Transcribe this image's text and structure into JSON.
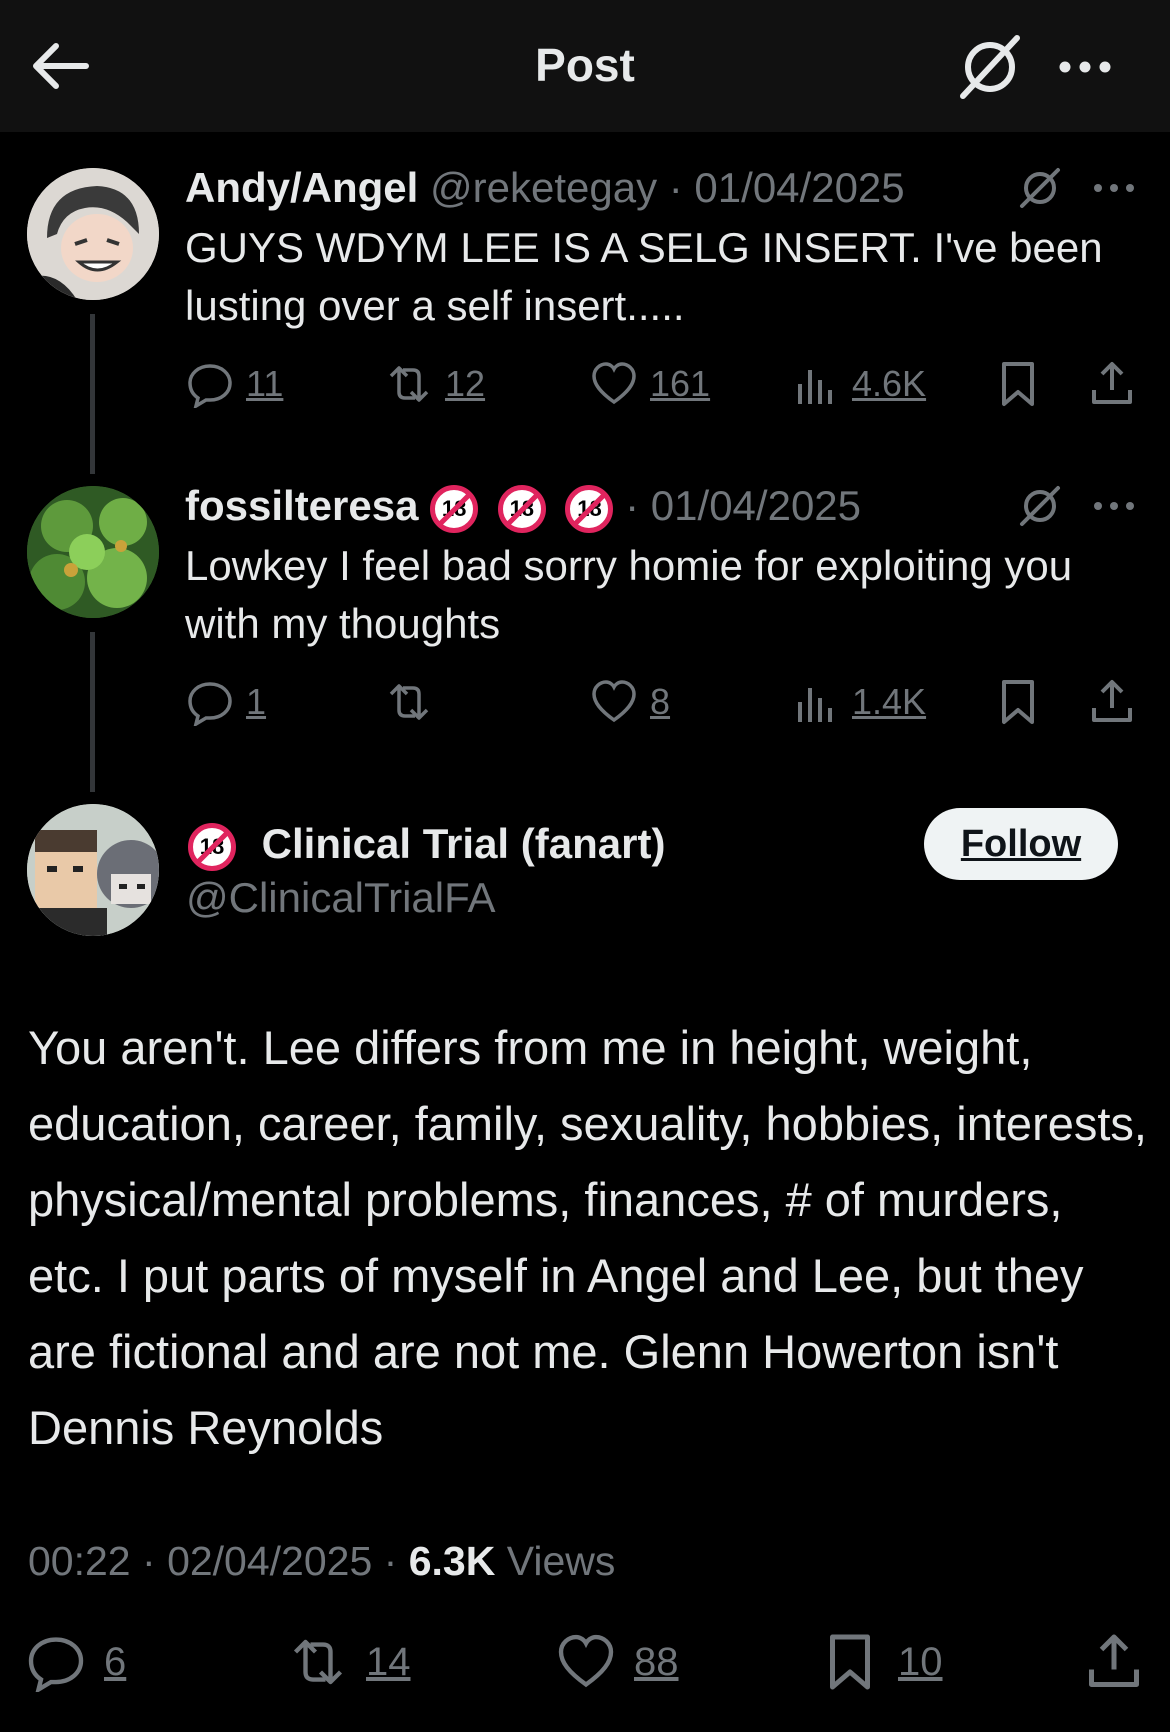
{
  "header": {
    "title": "Post",
    "back_icon": "arrow-left-icon",
    "grok_icon": "grok-icon",
    "more_icon": "more-horizontal-icon"
  },
  "thread": [
    {
      "display_name": "Andy/Angel",
      "handle": "@reketegay",
      "date": "· 01/04/2025",
      "text": "GUYS WDYM LEE IS A SELG INSERT. I've been lusting over a self insert.....",
      "replies": "11",
      "reposts": "12",
      "likes": "161",
      "views": "4.6K"
    },
    {
      "display_name": "fossilteresa",
      "badges": [
        "18+",
        "18+",
        "18+"
      ],
      "date": "· 01/04/2025",
      "text": "Lowkey I feel bad sorry homie for exploiting you with my thoughts",
      "replies": "1",
      "reposts": "",
      "likes": "8",
      "views": "1.4K"
    }
  ],
  "main_post": {
    "display_name": "Clinical Trial (fanart)",
    "handle": "@ClinicalTrialFA",
    "follow_label": "Follow",
    "text": "You aren't. Lee differs from me in height, weight, education, career, family, sexuality, hobbies, interests, physical/mental problems, finances, # of murders, etc. I put parts of myself in Angel and Lee, but they are fictional and are not me. Glenn Howerton isn't Dennis Reynolds",
    "time": "00:22",
    "date": "02/04/2025",
    "views_count": "6.3K",
    "views_label": "Views",
    "replies": "6",
    "reposts": "14",
    "likes": "88",
    "bookmarks": "10"
  },
  "colors": {
    "background": "#000000",
    "header": "#111111",
    "text": "#e7e9ea",
    "muted": "#71767b",
    "badge_red": "#e0245e"
  }
}
